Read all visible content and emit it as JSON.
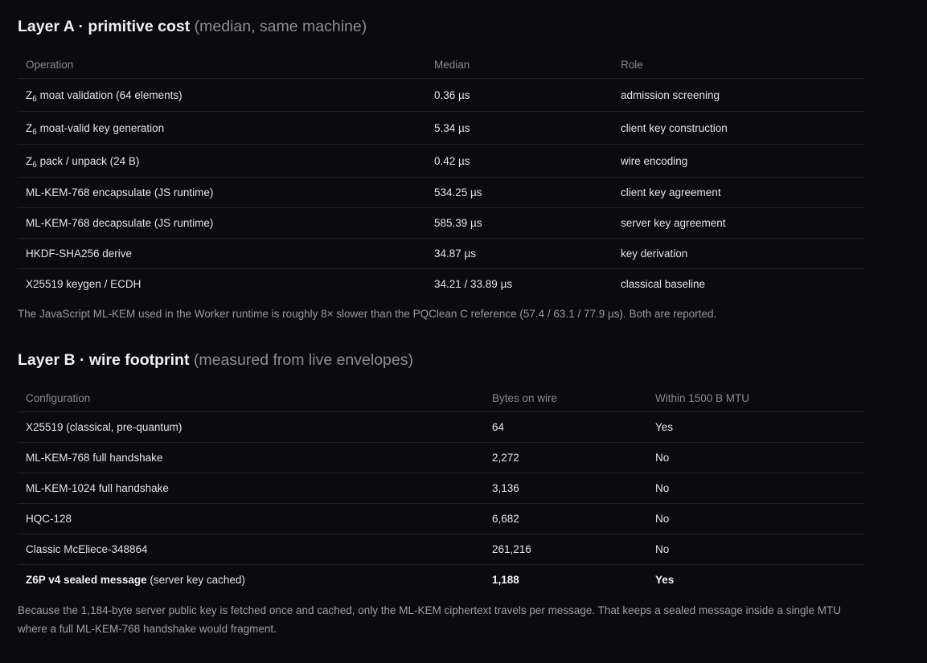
{
  "layer_a": {
    "title": "Layer A · primitive cost",
    "subtitle": "(median, same machine)",
    "columns": [
      "Operation",
      "Median",
      "Role"
    ],
    "rows": [
      {
        "prefix": "Z",
        "sub": "6",
        "operation": " moat validation (64 elements)",
        "median": "0.36 µs",
        "role": "admission screening"
      },
      {
        "prefix": "Z",
        "sub": "6",
        "operation": " moat-valid key generation",
        "median": "5.34 µs",
        "role": "client key construction"
      },
      {
        "prefix": "Z",
        "sub": "6",
        "operation": " pack / unpack (24 B)",
        "median": "0.42 µs",
        "role": "wire encoding"
      },
      {
        "operation": "ML-KEM-768 encapsulate (JS runtime)",
        "median": "534.25 µs",
        "role": "client key agreement"
      },
      {
        "operation": "ML-KEM-768 decapsulate (JS runtime)",
        "median": "585.39 µs",
        "role": "server key agreement"
      },
      {
        "operation": "HKDF-SHA256 derive",
        "median": "34.87 µs",
        "role": "key derivation"
      },
      {
        "operation": "X25519 keygen / ECDH",
        "median": "34.21 / 33.89 µs",
        "role": "classical baseline"
      }
    ],
    "note": "The JavaScript ML-KEM used in the Worker runtime is roughly 8× slower than the PQClean C reference (57.4 / 63.1 / 77.9 µs). Both are reported."
  },
  "layer_b": {
    "title": "Layer B · wire footprint",
    "subtitle": "(measured from live envelopes)",
    "columns": [
      "Configuration",
      "Bytes on wire",
      "Within 1500 B MTU"
    ],
    "rows": [
      {
        "config": "X25519 (classical, pre-quantum)",
        "bytes": "64",
        "mtu": "Yes"
      },
      {
        "config": "ML-KEM-768 full handshake",
        "bytes": "2,272",
        "mtu": "No"
      },
      {
        "config": "ML-KEM-1024 full handshake",
        "bytes": "3,136",
        "mtu": "No"
      },
      {
        "config": "HQC-128",
        "bytes": "6,682",
        "mtu": "No"
      },
      {
        "config": "Classic McEliece-348864",
        "bytes": "261,216",
        "mtu": "No"
      },
      {
        "config_bold": "Z6P v4 sealed message",
        "config": " (server key cached)",
        "bytes": "1,188",
        "mtu": "Yes"
      }
    ],
    "note": "Because the 1,184-byte server public key is fetched once and cached, only the ML-KEM ciphertext travels per message. That keeps a sealed message inside a single MTU where a full ML-KEM-768 handshake would fragment."
  }
}
